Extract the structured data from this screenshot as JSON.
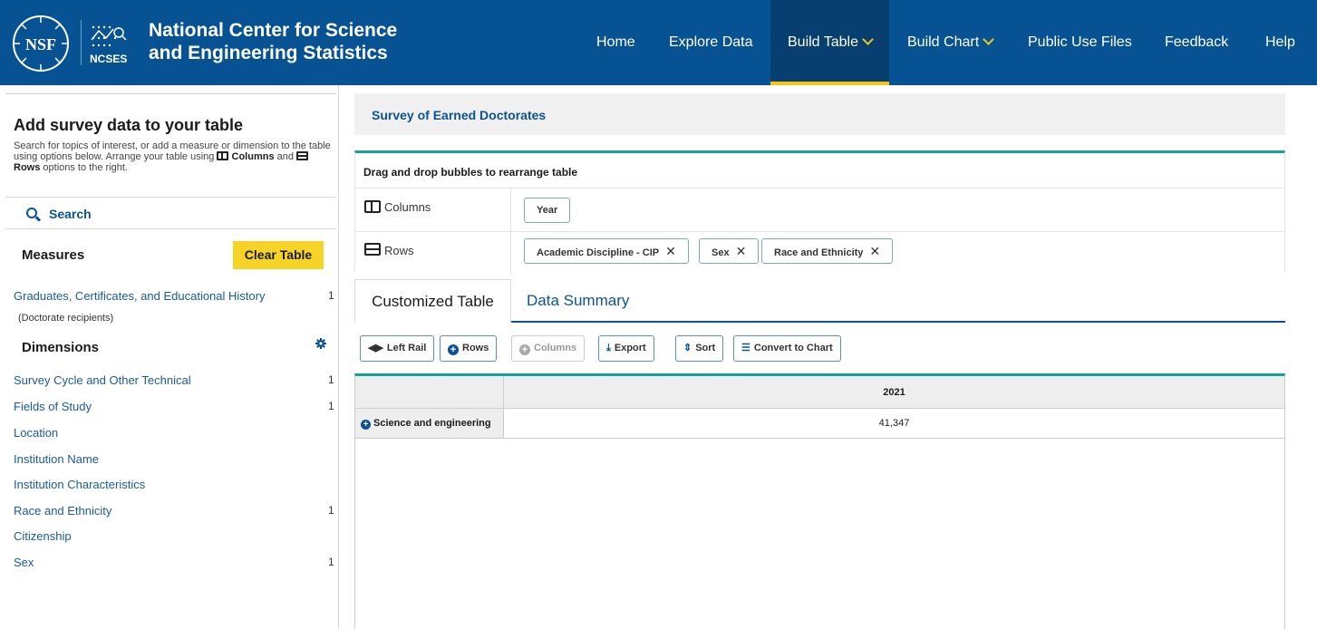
{
  "header": {
    "title_line1": "National Center for Science",
    "title_line2": "and Engineering Statistics",
    "logo_text": "NSF",
    "sub_logo_text": "NCSES",
    "nav": {
      "home": "Home",
      "explore": "Explore Data",
      "build_table": "Build Table",
      "build_chart": "Build Chart",
      "public_use": "Public Use Files",
      "feedback": "Feedback",
      "help": "Help"
    }
  },
  "left": {
    "heading": "Add survey data to your table",
    "intro_1": "Search for topics of interest, or add a measure or dimension to the table using options below. Arrange your table using",
    "intro_columns": "Columns",
    "intro_and": "and",
    "intro_rows": "Rows",
    "intro_2": "options to the right.",
    "search_label": "Search",
    "measures_heading": "Measures",
    "clear_button": "Clear Table",
    "measures": [
      {
        "label": "Graduates, Certificates, and Educational History",
        "count": "1",
        "sub": "(Doctorate recipients)"
      }
    ],
    "dimensions_heading": "Dimensions",
    "dimensions": [
      {
        "label": "Survey Cycle and Other Technical",
        "count": "1"
      },
      {
        "label": "Fields of Study",
        "count": "1"
      },
      {
        "label": "Location",
        "count": ""
      },
      {
        "label": "Institution Name",
        "count": ""
      },
      {
        "label": "Institution Characteristics",
        "count": ""
      },
      {
        "label": "Race and Ethnicity",
        "count": "1"
      },
      {
        "label": "Citizenship",
        "count": ""
      },
      {
        "label": "Sex",
        "count": "1"
      }
    ]
  },
  "main": {
    "survey_title": "Survey of Earned Doctorates",
    "dnd_title": "Drag and drop bubbles to rearrange table",
    "columns_label": "Columns",
    "rows_label": "Rows",
    "column_pills": [
      "Year"
    ],
    "row_pills": [
      "Academic Discipline - CIP",
      "Sex",
      "Race and Ethnicity"
    ],
    "remove_glyph": "✕",
    "tabs": {
      "active": "Customized Table",
      "inactive": "Data Summary"
    },
    "toolbar": {
      "left_rail": "Left Rail",
      "rows": "Rows",
      "columns": "Columns",
      "export": "Export",
      "sort": "Sort",
      "convert": "Convert to Chart"
    },
    "table": {
      "column_header": "2021",
      "row_label": "Science and engineering",
      "row_value": "41,347"
    }
  },
  "colors": {
    "header_bg": "#075292",
    "accent_yellow": "#f5c518",
    "teal_rule": "#14a2a0",
    "link_blue": "#1a5a99"
  }
}
